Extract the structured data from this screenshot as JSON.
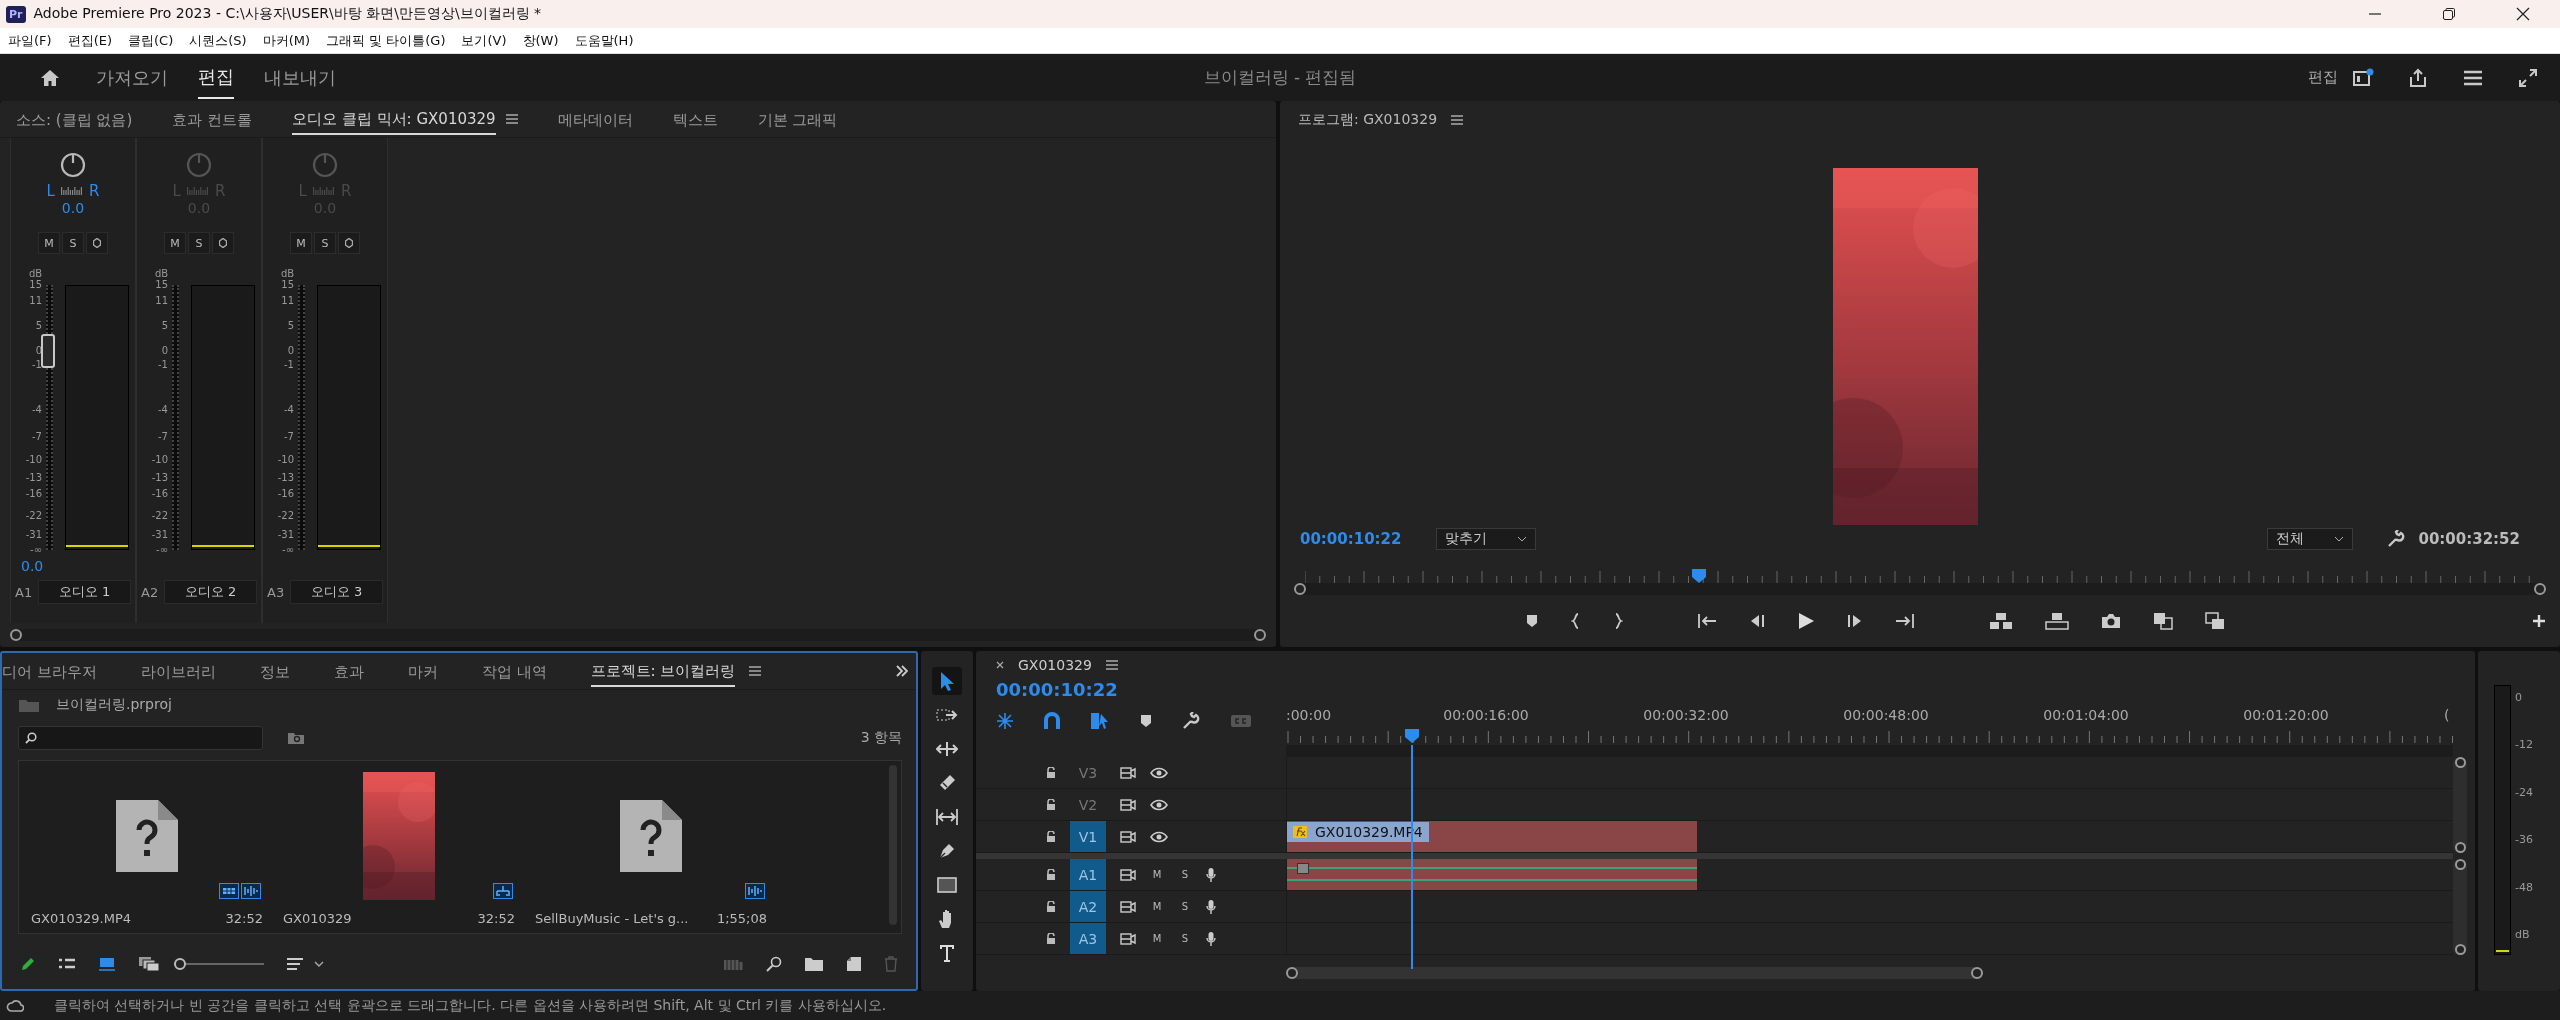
{
  "window": {
    "icon": "Pr",
    "title": "Adobe Premiere Pro 2023 - C:\\사용자\\USER\\바탕 화면\\만든영상\\브이컬러링 *"
  },
  "menu": [
    "파일(F)",
    "편집(E)",
    "클립(C)",
    "시퀀스(S)",
    "마커(M)",
    "그래픽 및 타이틀(G)",
    "보기(V)",
    "창(W)",
    "도움말(H)"
  ],
  "header": {
    "workspaces": [
      {
        "label": "가져오기",
        "selected": false
      },
      {
        "label": "편집",
        "selected": true
      },
      {
        "label": "내보내기",
        "selected": false
      }
    ],
    "project_title": "브이컬러링 - 편집됨",
    "workspace_label": "편집"
  },
  "source_tabs": [
    {
      "label": "소스: (클립 없음)",
      "selected": false
    },
    {
      "label": "효과 컨트롤",
      "selected": false
    },
    {
      "label": "오디오 클립 믹서: GX010329",
      "selected": true
    },
    {
      "label": "메타데이터",
      "selected": false
    },
    {
      "label": "텍스트",
      "selected": false
    },
    {
      "label": "기본 그래픽",
      "selected": false
    }
  ],
  "mixer": {
    "channels": [
      {
        "active": true,
        "left": "L",
        "right": "R",
        "pan": "0.0",
        "buttons": [
          "M",
          "S"
        ],
        "unit": "dB",
        "scale": [
          "15",
          "11",
          "5",
          "0",
          "-1",
          "-4",
          "-7",
          "-10",
          "-13",
          "-16",
          "-22",
          "-31",
          "-∞"
        ],
        "level": 0.75,
        "reading": "0.0",
        "track": "A1",
        "name": "오디오 1"
      },
      {
        "active": false,
        "left": "L",
        "right": "R",
        "pan": "0.0",
        "buttons": [
          "M",
          "S"
        ],
        "unit": "dB",
        "scale": [
          "15",
          "11",
          "5",
          "0",
          "-1",
          "-4",
          "-7",
          "-10",
          "-13",
          "-16",
          "-22",
          "-31",
          "-∞"
        ],
        "track": "A2",
        "name": "오디오 2"
      },
      {
        "active": false,
        "left": "L",
        "right": "R",
        "pan": "0.0",
        "buttons": [
          "M",
          "S"
        ],
        "unit": "dB",
        "scale": [
          "15",
          "11",
          "5",
          "0",
          "-1",
          "-4",
          "-7",
          "-10",
          "-13",
          "-16",
          "-22",
          "-31",
          "-∞"
        ],
        "track": "A3",
        "name": "오디오 3"
      }
    ]
  },
  "program": {
    "title": "프로그램: GX010329",
    "timecode": "00:00:10:22",
    "zoom": "맞추기",
    "quality": "전체",
    "duration": "00:00:32:52",
    "playhead": {
      "level": 0.32
    }
  },
  "project": {
    "tabs": [
      {
        "label": "디어 브라우저",
        "selected": false
      },
      {
        "label": "라이브러리",
        "selected": false
      },
      {
        "label": "정보",
        "selected": false
      },
      {
        "label": "효과",
        "selected": false
      },
      {
        "label": "마커",
        "selected": false
      },
      {
        "label": "작업 내역",
        "selected": false
      },
      {
        "label": "프로젝트: 브이컬러링",
        "selected": true
      }
    ],
    "file": "브이컬러링.prproj",
    "count": "3 항목",
    "items": [
      {
        "kind": "offline",
        "name": "GX010329.MP4",
        "duration": "32:52",
        "badges": [
          {
            "kind": "video"
          },
          {
            "kind": "audio"
          }
        ]
      },
      {
        "kind": "sequence",
        "name": "GX010329",
        "duration": "32:52",
        "badges": [
          {
            "kind": "sequence"
          }
        ]
      },
      {
        "kind": "offline",
        "name": "SellBuyMusic - Let's g...",
        "duration": "1;55;08",
        "badges": [
          {
            "kind": "audio"
          }
        ]
      }
    ],
    "icon_size": {
      "level": 0
    }
  },
  "tools": [
    {
      "kind": "select",
      "selected": true
    },
    {
      "kind": "track-select",
      "selected": false
    },
    {
      "kind": "ripple",
      "selected": false
    },
    {
      "kind": "razor",
      "selected": false
    },
    {
      "kind": "slip",
      "selected": false
    },
    {
      "kind": "pen",
      "selected": false
    },
    {
      "kind": "rectangle",
      "selected": false
    },
    {
      "kind": "hand",
      "selected": false
    },
    {
      "kind": "type",
      "selected": false
    }
  ],
  "timeline": {
    "title": "GX010329",
    "timecode": "00:00:10:22",
    "ruler": [
      ":00:00",
      "00:00:16:00",
      "00:00:32:00",
      "00:00:48:00",
      "00:01:04:00",
      "00:01:20:00",
      "("
    ],
    "playhead": {
      "level": 0.108
    },
    "tracks": [
      {
        "kind": "video",
        "name": "V3",
        "targeted": false
      },
      {
        "kind": "video",
        "name": "V2",
        "targeted": false
      },
      {
        "kind": "video",
        "name": "V1",
        "targeted": true,
        "clip": {
          "kind": "video",
          "label": "GX010329.MP4"
        }
      },
      {
        "kind": "audio",
        "name": "A1",
        "targeted": true,
        "buttons": [
          "M",
          "S"
        ],
        "clip": {
          "kind": "audio"
        }
      },
      {
        "kind": "audio",
        "name": "A2",
        "targeted": true,
        "buttons": [
          "M",
          "S"
        ]
      },
      {
        "kind": "audio",
        "name": "A3",
        "targeted": true,
        "buttons": [
          "M",
          "S"
        ]
      }
    ]
  },
  "meter": {
    "scale": [
      "0",
      "-12",
      "-24",
      "-36",
      "-48"
    ],
    "unit": "dB"
  },
  "status_bar": "클릭하여 선택하거나 빈 공간을 클릭하고 선택 윤곽으로 드래그합니다. 다른 옵션을 사용하려면 Shift, Alt 및 Ctrl 키를 사용하십시오."
}
